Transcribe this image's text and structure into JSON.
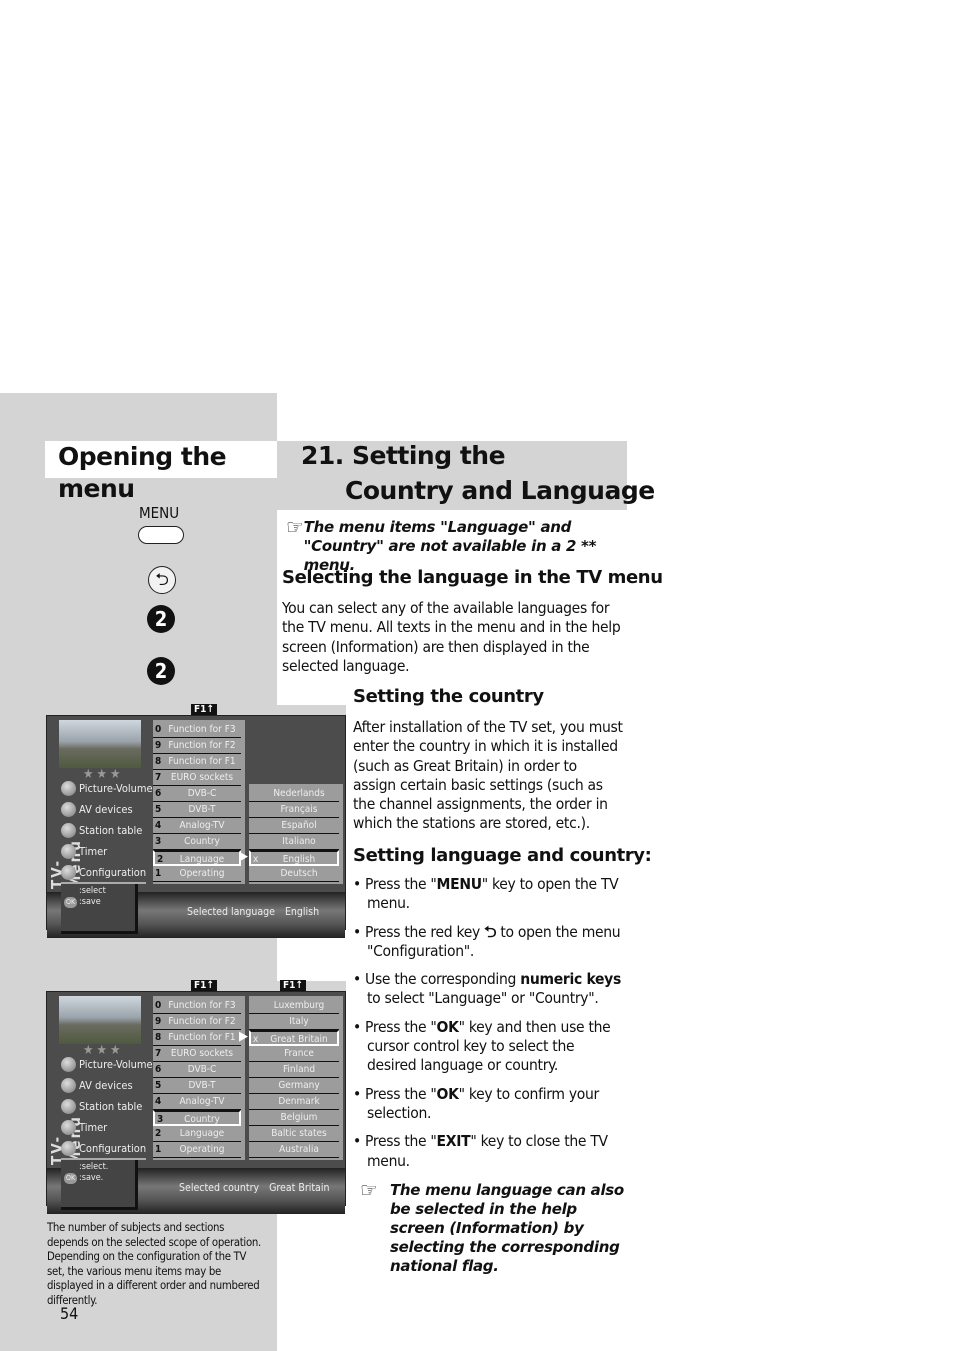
{
  "left": {
    "title": "Opening the menu",
    "menu_key_label": "MENU",
    "red_key_icon": "return-arrow",
    "step_numbers": [
      "2",
      "2"
    ],
    "caption": "The number of subjects and sections depends on the selected scope of operation. Depending on the configuration of the TV set, the various menu items may be displayed in a different order and numbered differently.",
    "page_number": "54"
  },
  "section": {
    "title_line1": "21. Setting the",
    "title_line2": "Country and Language",
    "note1": "The menu items \"Language\" and \"Country\" are not available in a 2 ** menu.",
    "h_lang": "Selecting the language in the TV menu",
    "p_lang": "You can select any of the available languages for the TV menu. All texts in the menu and in the help screen (Information) are then displayed in the selected language.",
    "h_country": "Setting the country",
    "p_country": "After installation of the TV set, you must enter the country in which it is installed (such as Great Britain) in order to assign certain basic settings (such as the channel assignments, the order in which the stations are stored, etc.).",
    "h_both": "Setting language and country:",
    "steps": [
      [
        "• Press the \"",
        "MENU",
        "\" key to open the TV menu."
      ],
      [
        "• Press the red key ",
        "⮌",
        " to open the menu \"Configuration\"."
      ],
      [
        "• Use the corresponding ",
        "numeric keys",
        " to select \"Language\" or \"Country\"."
      ],
      [
        "• Press the \"",
        "OK",
        "\" key and then use the cursor control key to select the desired language or country."
      ],
      [
        "• Press the \"",
        "OK",
        "\" key to confirm your selection."
      ],
      [
        "• Press the \"",
        "EXIT",
        "\" key to close the TV menu."
      ]
    ],
    "note2": "The menu language can also be selected in the help screen (Information) by selecting the corresponding national flag."
  },
  "tv_menus": [
    {
      "vertical_label": "TV-Menu",
      "f1": "F1↑",
      "left_items": [
        "Picture-Volume",
        "AV devices",
        "Station table",
        "Timer",
        "Configuration"
      ],
      "mid_items": [
        [
          "0",
          "Function for F3"
        ],
        [
          "9",
          "Function for F2"
        ],
        [
          "8",
          "Function for F1"
        ],
        [
          "7",
          "EURO sockets"
        ],
        [
          "6",
          "DVB-C"
        ],
        [
          "5",
          "DVB-T"
        ],
        [
          "4",
          "Analog-TV"
        ],
        [
          "3",
          "Country"
        ],
        [
          "2",
          "Language"
        ],
        [
          "1",
          "Operating"
        ]
      ],
      "mid_selected": 8,
      "right_items": [
        "Nederlands",
        "Français",
        "Español",
        "Italiano",
        "English",
        "Deutsch"
      ],
      "right_selected": 4,
      "right_f1": "",
      "help": [
        ":select",
        ":save"
      ],
      "ok_label": "OK",
      "status_label": "Selected language",
      "status_value": "English"
    },
    {
      "vertical_label": "TV-Menu",
      "f1": "F1↑",
      "left_items": [
        "Picture-Volume",
        "AV devices",
        "Station table",
        "Timer",
        "Configuration"
      ],
      "mid_items": [
        [
          "0",
          "Function for F3"
        ],
        [
          "9",
          "Function for F2"
        ],
        [
          "8",
          "Function for F1"
        ],
        [
          "7",
          "EURO sockets"
        ],
        [
          "6",
          "DVB-C"
        ],
        [
          "5",
          "DVB-T"
        ],
        [
          "4",
          "Analog-TV"
        ],
        [
          "3",
          "Country"
        ],
        [
          "2",
          "Language"
        ],
        [
          "1",
          "Operating"
        ]
      ],
      "mid_selected": 7,
      "right_items": [
        "Luxemburg",
        "Italy",
        "Great Britain",
        "France",
        "Finland",
        "Germany",
        "Denmark",
        "Belgium",
        "Baltic states",
        "Australia"
      ],
      "right_selected": 2,
      "right_f1": "F1↑",
      "help": [
        ":select.",
        ":save."
      ],
      "ok_label": "OK",
      "status_label": "Selected country",
      "status_value": "Great Britain"
    }
  ]
}
